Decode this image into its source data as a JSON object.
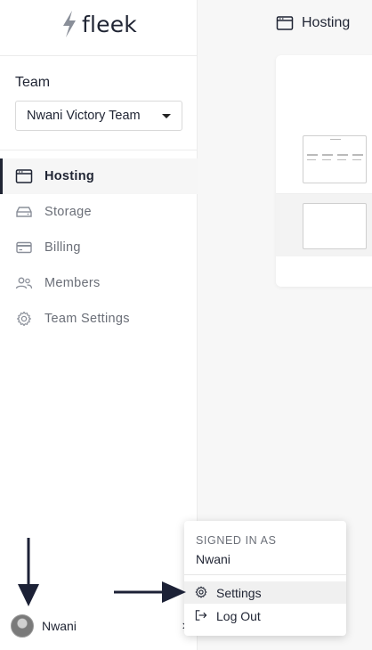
{
  "app": {
    "logo_text": "fleek"
  },
  "team": {
    "label": "Team",
    "selected": "Nwani Victory Team"
  },
  "nav": {
    "items": [
      {
        "label": "Hosting",
        "icon": "browser-window-icon",
        "active": true
      },
      {
        "label": "Storage",
        "icon": "drive-icon",
        "active": false
      },
      {
        "label": "Billing",
        "icon": "credit-card-icon",
        "active": false
      },
      {
        "label": "Members",
        "icon": "users-icon",
        "active": false
      },
      {
        "label": "Team Settings",
        "icon": "gear-icon",
        "active": false
      }
    ]
  },
  "user": {
    "name": "Nwani"
  },
  "main": {
    "title": "Hosting"
  },
  "account_menu": {
    "heading": "SIGNED IN AS",
    "username": "Nwani",
    "items": [
      {
        "label": "Settings",
        "icon": "gear-icon"
      },
      {
        "label": "Log Out",
        "icon": "logout-icon"
      }
    ]
  },
  "colors": {
    "text": "#1f2433",
    "muted": "#6b6f78",
    "arrow": "#1c2136"
  }
}
